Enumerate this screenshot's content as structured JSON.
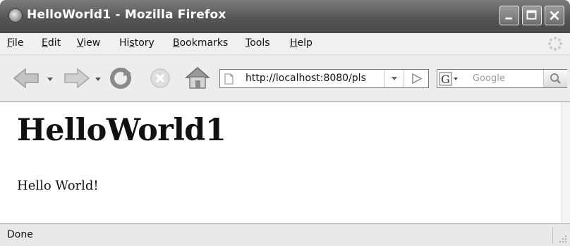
{
  "window": {
    "title": "HelloWorld1 - Mozilla Firefox",
    "buttons": [
      "minimize-icon",
      "maximize-icon",
      "close-icon"
    ]
  },
  "menubar": {
    "items": [
      {
        "first": "F",
        "rest": "ile"
      },
      {
        "first": "E",
        "rest": "dit"
      },
      {
        "first": "V",
        "rest": "iew"
      },
      {
        "pre": "Hi",
        "first": "s",
        "rest": "tory"
      },
      {
        "first": "B",
        "rest": "ookmarks"
      },
      {
        "first": "T",
        "rest": "ools"
      },
      {
        "first": "H",
        "rest": "elp"
      }
    ]
  },
  "navbar": {
    "icons": [
      "back-arrow-icon",
      "forward-arrow-icon",
      "reload-icon",
      "stop-icon",
      "home-icon"
    ],
    "url": "http://localhost:8080/pls",
    "search_placeholder": "Google",
    "search_engine_letter": "G"
  },
  "content": {
    "heading": "HelloWorld1",
    "paragraph": "Hello World!"
  },
  "status": {
    "text": "Done"
  }
}
